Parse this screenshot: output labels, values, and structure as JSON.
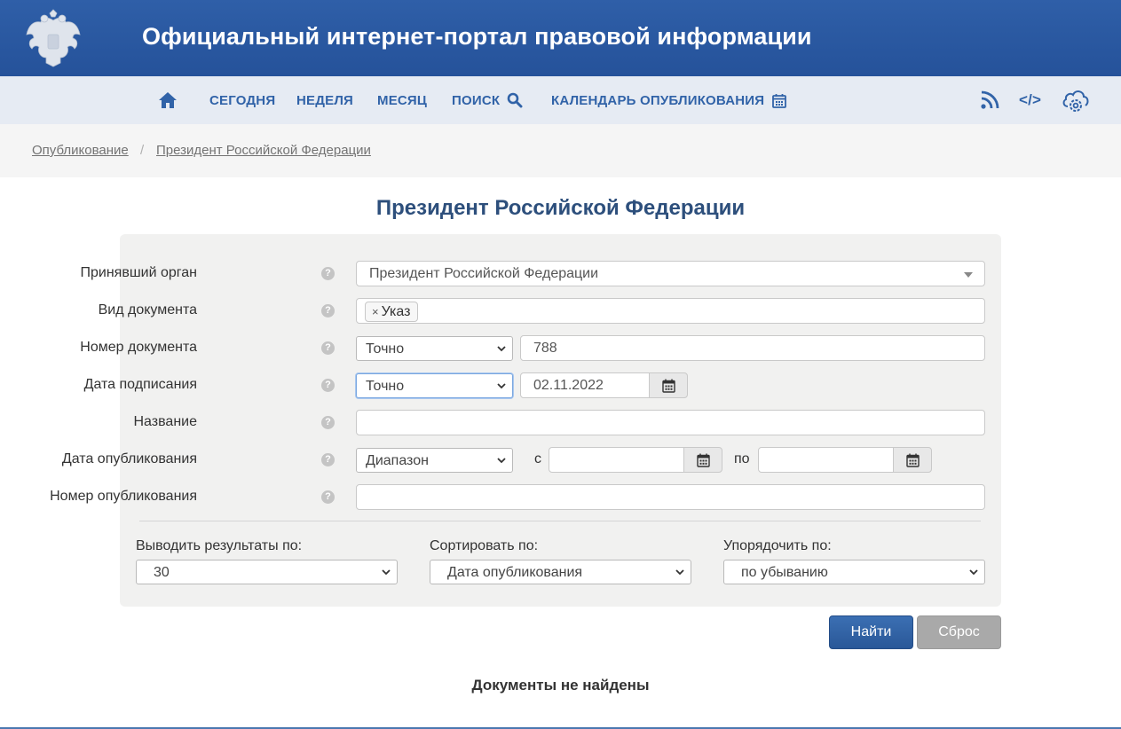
{
  "header": {
    "title": "Официальный интернет-портал правовой информации"
  },
  "nav": {
    "items": [
      {
        "label": "СЕГОДНЯ"
      },
      {
        "label": "НЕДЕЛЯ"
      },
      {
        "label": "МЕСЯЦ"
      },
      {
        "label": "ПОИСК"
      },
      {
        "label": "КАЛЕНДАРЬ ОПУБЛИКОВАНИЯ"
      }
    ],
    "code_label": "</>"
  },
  "breadcrumb": {
    "items": [
      "Опубликование",
      "Президент Российской Федерации"
    ],
    "separator": "/"
  },
  "page_title": "Президент Российской Федерации",
  "form": {
    "help_glyph": "?",
    "authority": {
      "label": "Принявший орган",
      "value": "Президент Российской Федерации"
    },
    "doc_type": {
      "label": "Вид документа",
      "tag": "Указ",
      "tag_remove": "×"
    },
    "doc_number": {
      "label": "Номер документа",
      "mode": "Точно",
      "value": "788"
    },
    "sign_date": {
      "label": "Дата подписания",
      "mode": "Точно",
      "value": "02.11.2022"
    },
    "name": {
      "label": "Название",
      "value": ""
    },
    "pub_date": {
      "label": "Дата опубликования",
      "mode": "Диапазон",
      "from_label": "с",
      "to_label": "по",
      "from": "",
      "to": ""
    },
    "pub_number": {
      "label": "Номер опубликования",
      "value": ""
    },
    "per_page": {
      "label": "Выводить результаты по:",
      "value": "30"
    },
    "sort_by": {
      "label": "Сортировать по:",
      "value": "Дата опубликования"
    },
    "order": {
      "label": "Упорядочить по:",
      "value": "по убыванию"
    }
  },
  "buttons": {
    "find": "Найти",
    "reset": "Сброс"
  },
  "results": {
    "empty_text": "Документы не найдены"
  },
  "colors": {
    "header": "#2f5fa8",
    "nav_text": "#3163a8",
    "title": "#2d4f7c",
    "find_button": "#2a5898",
    "reset_button": "#a9a9a9"
  }
}
